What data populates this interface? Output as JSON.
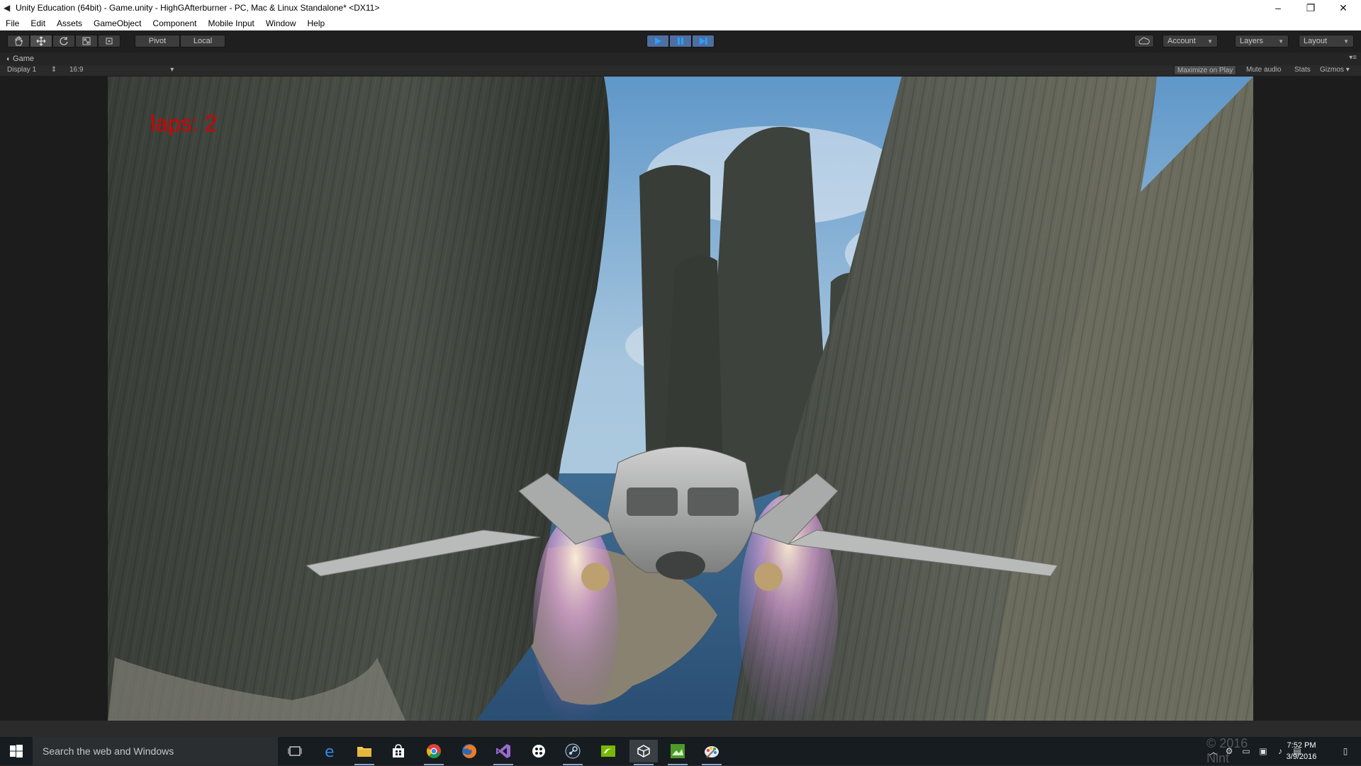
{
  "window": {
    "title": "Unity Education (64bit) - Game.unity - HighGAfterburner - PC, Mac & Linux Standalone* <DX11>",
    "controls": {
      "minimize": "–",
      "restore": "❐",
      "close": "✕"
    }
  },
  "menu": [
    "File",
    "Edit",
    "Assets",
    "GameObject",
    "Component",
    "Mobile Input",
    "Window",
    "Help"
  ],
  "toolbar": {
    "pivot_label": "Pivot",
    "local_label": "Local",
    "account_label": "Account",
    "layers_label": "Layers",
    "layout_label": "Layout",
    "play_state": "playing"
  },
  "game_panel": {
    "tab_label": "Game",
    "display": "Display 1",
    "aspect": "16:9",
    "maximize_label": "Maximize on Play",
    "mute_label": "Mute audio",
    "stats_label": "Stats",
    "gizmos_label": "Gizmos"
  },
  "game": {
    "hud_laps": "laps: 2"
  },
  "taskbar": {
    "search_placeholder": "Search the web and Windows",
    "time": "7:52 PM",
    "date": "3/9/2016",
    "watermark": "© 2016 Nint"
  },
  "colors": {
    "hud_text": "#d40000",
    "toolbar_bg": "#1f1f1f",
    "taskbar_bg": "#171c20",
    "play_active": "#4f6fa0"
  },
  "icons": [
    "hand-tool-icon",
    "move-tool-icon",
    "rotate-tool-icon",
    "scale-tool-icon",
    "rect-tool-icon",
    "play-icon",
    "pause-icon",
    "step-icon",
    "cloud-icon",
    "windows-logo-icon"
  ]
}
